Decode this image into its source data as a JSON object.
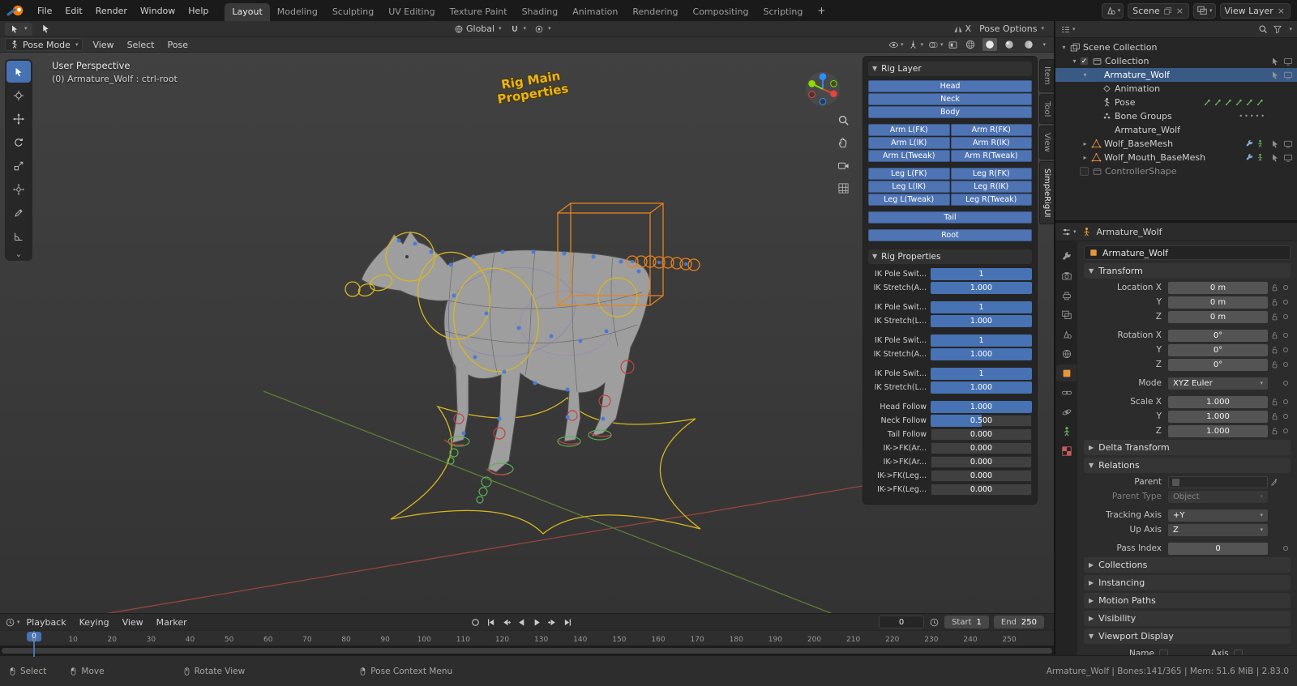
{
  "colors": {
    "accent": "#4772b3",
    "button_blue": "#4f74b3",
    "slider_fill": "#4772b3",
    "selected_row": "#3a5a86",
    "control_yellow": "#d8b81e",
    "control_orange": "#e8821e",
    "control_green": "#58b058",
    "control_red": "#c84040",
    "axis_red": "#96463e",
    "axis_green": "#5f7d36",
    "gizmo_x": "#e3453f",
    "gizmo_y": "#8bdc00",
    "gizmo_z": "#2890ff"
  },
  "topbar": {
    "menus": [
      "File",
      "Edit",
      "Render",
      "Window",
      "Help"
    ],
    "workspaces": [
      "Layout",
      "Modeling",
      "Sculpting",
      "UV Editing",
      "Texture Paint",
      "Shading",
      "Animation",
      "Rendering",
      "Compositing",
      "Scripting"
    ],
    "active_workspace": "Layout",
    "add_workspace": "+",
    "scene_label": "Scene",
    "view_layer_label": "View Layer"
  },
  "tool_settings": {
    "orientation": "Global",
    "mirror_label": "X",
    "pose_options": "Pose Options"
  },
  "viewport": {
    "mode": "Pose Mode",
    "menus": [
      "View",
      "Select",
      "Pose"
    ],
    "overlay_line1": "User Perspective",
    "overlay_line2": "(0) Armature_Wolf : ctrl-root",
    "scene_text_line1": "Rig Main",
    "scene_text_line2": "Properties",
    "toolbar": [
      "box-select",
      "cursor",
      "move",
      "rotate",
      "scale",
      "transform",
      "annotate",
      "measure"
    ],
    "nav_icons": [
      "zoom",
      "hand",
      "camera",
      "grid"
    ],
    "header_toggles": [
      "visibility",
      "gizmos",
      "overlays",
      "xray"
    ],
    "shading_modes": [
      "wireframe",
      "solid",
      "material",
      "rendered"
    ],
    "active_shading": "solid",
    "side_tabs": [
      "Item",
      "Tool",
      "View",
      "SimpleRigUI"
    ],
    "active_side_tab": "SimpleRigUI"
  },
  "rig_panel": {
    "rig_layer_title": "Rig Layer",
    "layer_rows": [
      {
        "group": 0,
        "buttons": [
          "Head"
        ]
      },
      {
        "group": 0,
        "buttons": [
          "Neck"
        ]
      },
      {
        "group": 0,
        "buttons": [
          "Body"
        ]
      },
      {
        "group": 1,
        "buttons": [
          "Arm L(FK)",
          "Arm R(FK)"
        ]
      },
      {
        "group": 1,
        "buttons": [
          "Arm L(IK)",
          "Arm R(IK)"
        ]
      },
      {
        "group": 1,
        "buttons": [
          "Arm L(Tweak)",
          "Arm R(Tweak)"
        ]
      },
      {
        "group": 2,
        "buttons": [
          "Leg L(FK)",
          "Leg R(FK)"
        ]
      },
      {
        "group": 2,
        "buttons": [
          "Leg L(IK)",
          "Leg R(IK)"
        ]
      },
      {
        "group": 2,
        "buttons": [
          "Leg L(Tweak)",
          "Leg R(Tweak)"
        ]
      },
      {
        "group": 3,
        "buttons": [
          "Tail"
        ]
      },
      {
        "group": 4,
        "buttons": [
          "Root"
        ]
      }
    ],
    "rig_properties_title": "Rig Properties",
    "sliders": [
      {
        "group": 0,
        "label": "IK Pole Swit...",
        "value": "1",
        "fill": 1
      },
      {
        "group": 0,
        "label": "IK Stretch(A...",
        "value": "1.000",
        "fill": 1
      },
      {
        "group": 1,
        "label": "IK Pole Swit...",
        "value": "1",
        "fill": 1
      },
      {
        "group": 1,
        "label": "IK Stretch(L...",
        "value": "1.000",
        "fill": 1
      },
      {
        "group": 2,
        "label": "IK Pole Swit...",
        "value": "1",
        "fill": 1
      },
      {
        "group": 2,
        "label": "IK Stretch(A...",
        "value": "1.000",
        "fill": 1
      },
      {
        "group": 3,
        "label": "IK Pole Swit...",
        "value": "1",
        "fill": 1
      },
      {
        "group": 3,
        "label": "IK Stretch(L...",
        "value": "1.000",
        "fill": 1
      },
      {
        "group": 4,
        "label": "Head Follow",
        "value": "1.000",
        "fill": 1
      },
      {
        "group": 4,
        "label": "Neck Follow",
        "value": "0.500",
        "fill": 0.5
      },
      {
        "group": 4,
        "label": "Tail Follow",
        "value": "0.000",
        "fill": 0
      },
      {
        "group": 4,
        "label": "IK->FK(Ar...",
        "value": "0.000",
        "fill": 0
      },
      {
        "group": 4,
        "label": "IK->FK(Ar...",
        "value": "0.000",
        "fill": 0
      },
      {
        "group": 4,
        "label": "IK->FK(Leg...",
        "value": "0.000",
        "fill": 0
      },
      {
        "group": 4,
        "label": "IK->FK(Leg...",
        "value": "0.000",
        "fill": 0
      }
    ]
  },
  "outliner": {
    "rows": [
      {
        "label": "Scene Collection",
        "indent": 0,
        "icon": "scene-collection",
        "color": "gray",
        "caret": "open"
      },
      {
        "label": "Collection",
        "indent": 1,
        "icon": "collection",
        "color": "gray",
        "caret": "open",
        "checkbox": "checked",
        "right": [
          "pointer",
          "monitor"
        ]
      },
      {
        "label": "Armature_Wolf",
        "indent": 2,
        "icon": "armature",
        "color": "orange",
        "caret": "open",
        "selected": true,
        "right": [
          "pointer",
          "monitor"
        ]
      },
      {
        "label": "Animation",
        "indent": 3,
        "icon": "animation",
        "color": "gray"
      },
      {
        "label": "Pose",
        "indent": 3,
        "icon": "pose",
        "color": "gray",
        "extras": [
          "bone",
          "bone",
          "bone",
          "bone",
          "bone",
          "bone"
        ]
      },
      {
        "label": "Bone Groups",
        "indent": 3,
        "icon": "bone-groups",
        "color": "gray",
        "extras": [
          "dot",
          "dot",
          "dot",
          "dot",
          "dot"
        ]
      },
      {
        "label": "Armature_Wolf",
        "indent": 3,
        "icon": "armature",
        "color": "green"
      },
      {
        "label": "Wolf_BaseMesh",
        "indent": 2,
        "icon": "mesh",
        "color": "orange",
        "caret": "closed",
        "extras": [
          "wrench",
          "person"
        ],
        "right": [
          "pointer",
          "monitor"
        ]
      },
      {
        "label": "Wolf_Mouth_BaseMesh",
        "indent": 2,
        "icon": "mesh",
        "color": "orange",
        "caret": "closed",
        "extras": [
          "wrench",
          "person"
        ],
        "right": [
          "pointer",
          "monitor"
        ]
      },
      {
        "label": "ControllerShape",
        "indent": 1,
        "icon": "collection",
        "color": "dim",
        "checkbox": "unchecked",
        "dim": true
      }
    ]
  },
  "properties": {
    "breadcrumb": "Armature_Wolf",
    "object_name": "Armature_Wolf",
    "tabs": [
      "tool",
      "render",
      "output",
      "view-layer",
      "scene",
      "world",
      "object",
      "constraints",
      "physics",
      "data",
      "texture"
    ],
    "active_tab": "object",
    "transform_title": "Transform",
    "transform_rows": [
      {
        "label": "Location X",
        "value": "0 m",
        "lock": true,
        "dot": true
      },
      {
        "label": "Y",
        "value": "0 m",
        "lock": true,
        "dot": true
      },
      {
        "label": "Z",
        "value": "0 m",
        "lock": true,
        "dot": true
      },
      {
        "label": "Rotation X",
        "value": "0°",
        "lock": true,
        "dot": true,
        "gap": true
      },
      {
        "label": "Y",
        "value": "0°",
        "lock": true,
        "dot": true
      },
      {
        "label": "Z",
        "value": "0°",
        "lock": true,
        "dot": true
      },
      {
        "label": "Mode",
        "value": "XYZ Euler",
        "type": "dropdown",
        "dot": true,
        "gap": true
      },
      {
        "label": "Scale X",
        "value": "1.000",
        "lock": true,
        "dot": true,
        "gap": true
      },
      {
        "label": "Y",
        "value": "1.000",
        "lock": true,
        "dot": true
      },
      {
        "label": "Z",
        "value": "1.000",
        "lock": true,
        "dot": true
      }
    ],
    "delta_transform_title": "Delta Transform",
    "relations_title": "Relations",
    "relations_rows": [
      {
        "label": "Parent",
        "value": "",
        "type": "object-field"
      },
      {
        "label": "Parent Type",
        "value": "Object",
        "type": "dropdown",
        "disabled": true
      },
      {
        "label": "Tracking Axis",
        "value": "+Y",
        "type": "dropdown",
        "gap": true
      },
      {
        "label": "Up Axis",
        "value": "Z",
        "type": "dropdown"
      },
      {
        "label": "Pass Index",
        "value": "0",
        "dot": true,
        "gap": true
      }
    ],
    "collapsed_panels": [
      "Collections",
      "Instancing",
      "Motion Paths",
      "Visibility"
    ],
    "viewport_display_title": "Viewport Display",
    "viewport_display_checkboxes": [
      "Name",
      "Axis"
    ]
  },
  "timeline": {
    "menus": [
      "Playback",
      "Keying",
      "View",
      "Marker"
    ],
    "transport": [
      "record",
      "jump-start",
      "prev-keyframe",
      "play-back",
      "play",
      "next-keyframe",
      "jump-end"
    ],
    "current_frame": "0",
    "start_label": "Start",
    "start_value": "1",
    "end_label": "End",
    "end_value": "250",
    "frame_start": 0,
    "frame_end": 250,
    "label_step": 10,
    "playhead_frame": 0,
    "playhead_label": "0"
  },
  "statusbar": {
    "hints": [
      {
        "icon": "mouse-left",
        "label": "Select"
      },
      {
        "icon": "mouse-left",
        "label": "Move"
      },
      {
        "icon": "mouse-middle",
        "label": "Rotate View"
      },
      {
        "icon": "mouse-right",
        "label": "Pose Context Menu"
      }
    ],
    "info": "Armature_Wolf | Bones:141/365 | Mem: 51.6 MiB | 2.83.0"
  }
}
